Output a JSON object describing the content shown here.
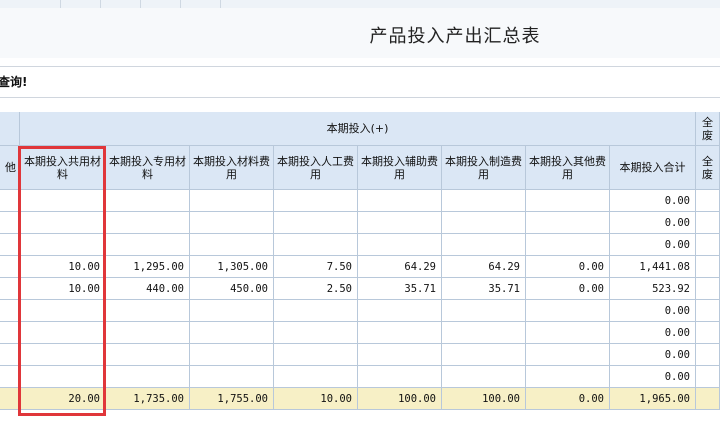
{
  "title": "产品投入产出汇总表",
  "message": "查询!",
  "group_header": "本期投入(+)",
  "next_group_header": "全废",
  "left_partial_col": "他",
  "columns": [
    "本期投入共用材料",
    "本期投入专用材料",
    "本期投入材料费用",
    "本期投入人工费用",
    "本期投入辅助费用",
    "本期投入制造费用",
    "本期投入其他费用",
    "本期投入合计"
  ],
  "right_partial_col": "全废",
  "rows": [
    [
      "",
      "",
      "",
      "",
      "",
      "",
      "",
      "0.00"
    ],
    [
      "",
      "",
      "",
      "",
      "",
      "",
      "",
      "0.00"
    ],
    [
      "",
      "",
      "",
      "",
      "",
      "",
      "",
      "0.00"
    ],
    [
      "10.00",
      "1,295.00",
      "1,305.00",
      "7.50",
      "64.29",
      "64.29",
      "0.00",
      "1,441.08"
    ],
    [
      "10.00",
      "440.00",
      "450.00",
      "2.50",
      "35.71",
      "35.71",
      "0.00",
      "523.92"
    ],
    [
      "",
      "",
      "",
      "",
      "",
      "",
      "",
      "0.00"
    ],
    [
      "",
      "",
      "",
      "",
      "",
      "",
      "",
      "0.00"
    ],
    [
      "",
      "",
      "",
      "",
      "",
      "",
      "",
      "0.00"
    ],
    [
      "",
      "",
      "",
      "",
      "",
      "",
      "",
      "0.00"
    ]
  ],
  "total_row": [
    "20.00",
    "1,735.00",
    "1,755.00",
    "10.00",
    "100.00",
    "100.00",
    "0.00",
    "1,965.00"
  ],
  "highlight_color": "#e0363a",
  "header_bg": "#dbe7f5",
  "total_bg": "#f7f0c6"
}
